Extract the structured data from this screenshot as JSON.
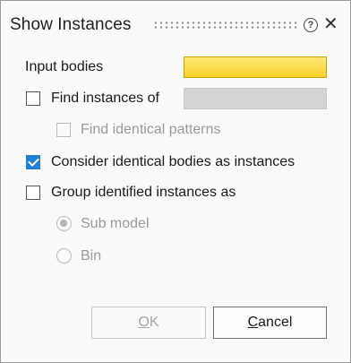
{
  "dialog": {
    "title": "Show Instances",
    "icons": {
      "help": "help-icon",
      "close": "close-icon",
      "grip": "drag-handle"
    }
  },
  "fields": {
    "input_bodies_label": "Input bodies",
    "find_instances_label": "Find instances of",
    "find_identical_patterns_label": "Find identical patterns",
    "consider_identical_label": "Consider identical bodies as instances",
    "group_label": "Group identified instances as",
    "sub_model_label": "Sub model",
    "bin_label": "Bin"
  },
  "state": {
    "find_instances_checked": false,
    "find_identical_patterns_checked": false,
    "consider_identical_checked": true,
    "group_checked": false,
    "group_option_selected": "Sub model"
  },
  "buttons": {
    "ok_label": "OK",
    "ok_mnemonic": "O",
    "cancel_label": "Cancel",
    "cancel_mnemonic": "C"
  },
  "colors": {
    "input_highlight": "#f7d12a",
    "checkbox_accent": "#1f7fd6"
  }
}
